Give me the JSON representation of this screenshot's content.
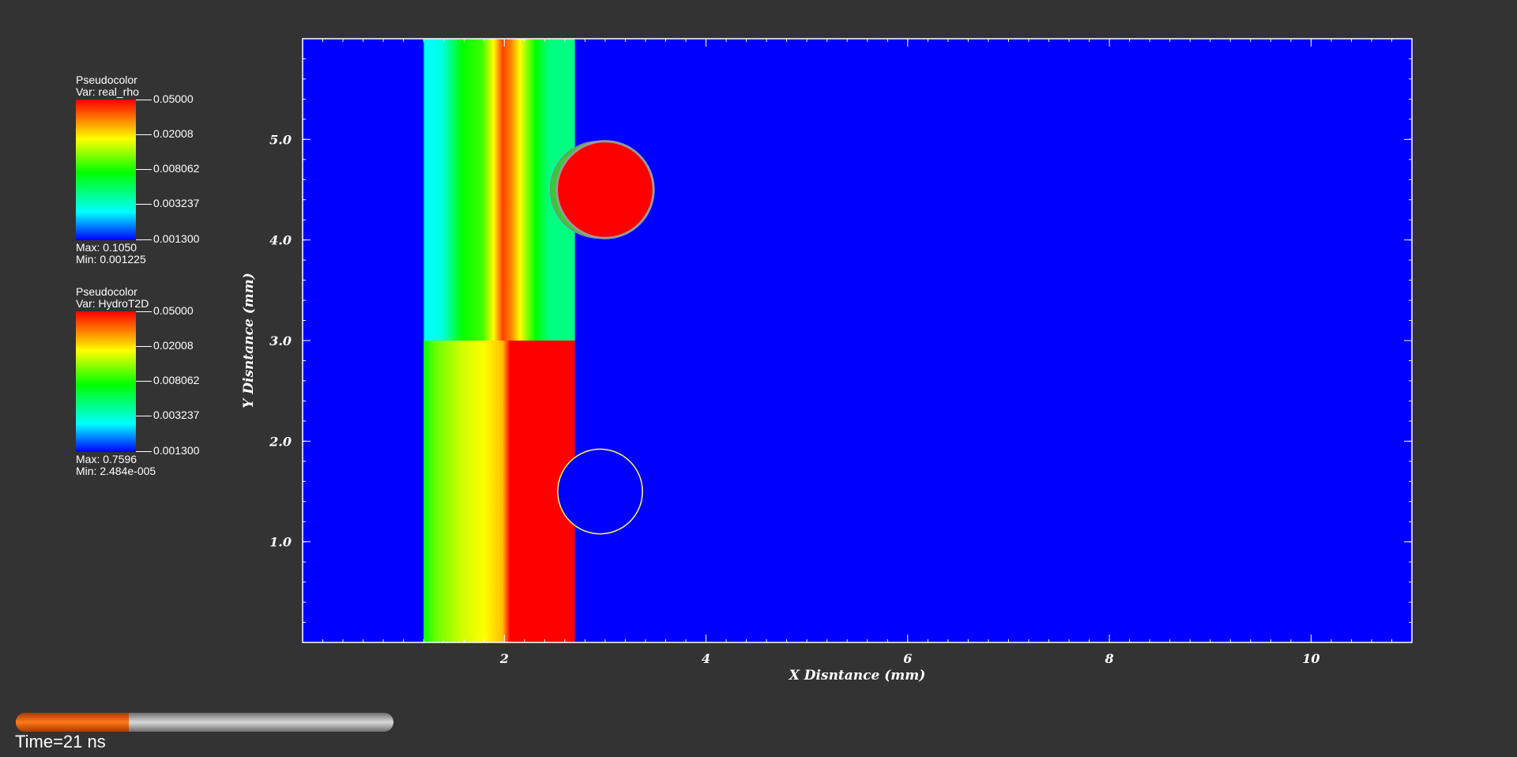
{
  "legends": [
    {
      "title": "Pseudocolor",
      "var_label": "Var: real_rho",
      "ticks": [
        "0.05000",
        "0.02008",
        "0.008062",
        "0.003237",
        "0.001300"
      ],
      "max_label": "Max:  0.1050",
      "min_label": "Min:  0.001225"
    },
    {
      "title": "Pseudocolor",
      "var_label": "Var: HydroT2D",
      "ticks": [
        "0.05000",
        "0.02008",
        "0.008062",
        "0.003237",
        "0.001300"
      ],
      "max_label": "Max:  0.7596",
      "min_label": "Min:  2.484e-005"
    }
  ],
  "colormap": [
    "#0000ff",
    "#00ffff",
    "#00ff00",
    "#ffff00",
    "#ff0000"
  ],
  "plot": {
    "xlabel": "X Disntance (mm)",
    "ylabel": "Y Disntance (mm)",
    "xlim": [
      0,
      11
    ],
    "ylim": [
      0,
      6
    ],
    "x_ticks": [
      2,
      4,
      6,
      8,
      10
    ],
    "x_tick_labels": [
      "2",
      "4",
      "6",
      "8",
      "10"
    ],
    "y_ticks": [
      1,
      2,
      3,
      4,
      5
    ],
    "y_tick_labels": [
      "1.0",
      "2.0",
      "3.0",
      "4.0",
      "5.0"
    ],
    "background_color": "#0000ff"
  },
  "field": {
    "upper_region": {
      "x_start": 1.2,
      "x_end": 2.7,
      "y_start": 3.0,
      "y_end": 6.0
    },
    "lower_region": {
      "x_start": 1.2,
      "x_end": 2.7,
      "y_start": 0.0,
      "y_end": 3.0
    },
    "droplet": {
      "cx": 3.0,
      "cy": 4.5,
      "r": 0.48
    },
    "cavity": {
      "cx": 2.95,
      "cy": 1.5,
      "r": 0.42
    }
  },
  "animation": {
    "progress": 0.3,
    "time_label": "Time=21 ns"
  }
}
